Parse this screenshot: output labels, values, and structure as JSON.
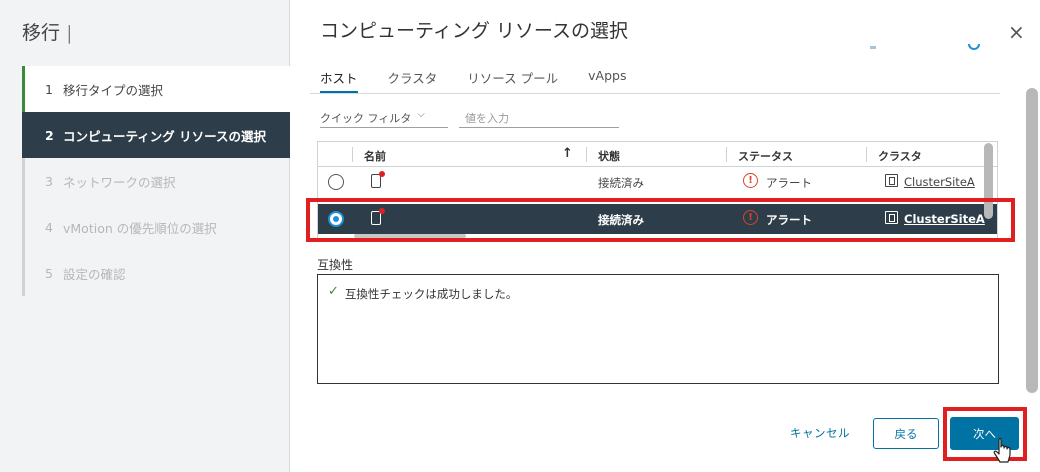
{
  "wizard": {
    "title": "移行 |",
    "steps": [
      {
        "num": "1",
        "label": "移行タイプの選択",
        "state": "done"
      },
      {
        "num": "2",
        "label": "コンピューティング リソースの選択",
        "state": "active"
      },
      {
        "num": "3",
        "label": "ネットワークの選択",
        "state": "disabled"
      },
      {
        "num": "4",
        "label": "vMotion の優先順位の選択",
        "state": "disabled"
      },
      {
        "num": "5",
        "label": "設定の確認",
        "state": "disabled"
      }
    ]
  },
  "dialog": {
    "title": "コンピューティング リソースの選択",
    "close_icon": "×"
  },
  "tabs": [
    {
      "label": "ホスト",
      "active": true
    },
    {
      "label": "クラスタ",
      "active": false
    },
    {
      "label": "リソース プール",
      "active": false
    },
    {
      "label": "vApps",
      "active": false
    }
  ],
  "filter": {
    "label": "クイック フィルタ",
    "chevron": "⌵",
    "placeholder": "値を入力"
  },
  "grid": {
    "columns": [
      "名前",
      "状態",
      "ステータス",
      "クラスタ"
    ],
    "sort_icon": "↑",
    "rows": [
      {
        "name": "",
        "state": "接続済み",
        "status": "アラート",
        "cluster": "ClusterSiteA",
        "selected": false
      },
      {
        "name": "",
        "state": "接続済み",
        "status": "アラート",
        "cluster": "ClusterSiteA",
        "selected": true
      }
    ]
  },
  "compatibility": {
    "label": "互換性",
    "message": "互換性チェックは成功しました。"
  },
  "footer": {
    "cancel": "キャンセル",
    "back": "戻る",
    "next": "次へ"
  },
  "colors": {
    "accent": "#0072a3",
    "selected_row": "#2d3e4a",
    "highlight": "#e02020",
    "success": "#3b8a3b",
    "alert": "#d9432b"
  }
}
